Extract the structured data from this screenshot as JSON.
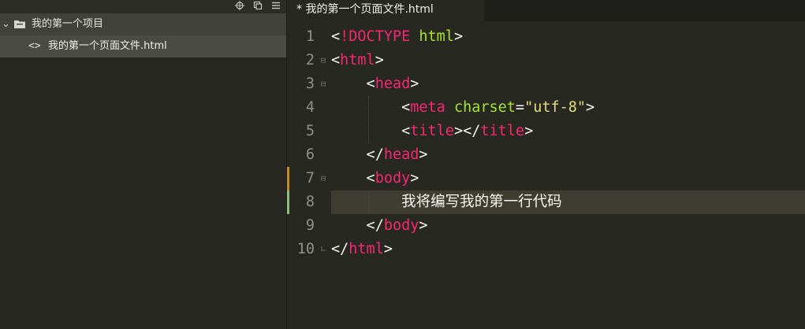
{
  "sidebar": {
    "toolbar": {
      "icons": [
        "crosshair-icon",
        "copy-icon",
        "menu-icon"
      ]
    },
    "project": {
      "name": "我的第一个项目",
      "expand_glyph": "⌄"
    },
    "file": {
      "name": "我的第一个页面文件.html",
      "glyph": "<>"
    }
  },
  "editor": {
    "tab": {
      "title": "* 我的第一个页面文件.html"
    },
    "code": {
      "lines": [
        {
          "num": "1",
          "fold": "",
          "parts": [
            {
              "c": "p",
              "t": "<"
            },
            {
              "c": "t",
              "t": "!DOCTYPE"
            },
            {
              "c": "p",
              "t": " "
            },
            {
              "c": "a",
              "t": "html"
            },
            {
              "c": "p",
              "t": ">"
            }
          ]
        },
        {
          "num": "2",
          "fold": "⊟",
          "parts": [
            {
              "c": "p",
              "t": "<"
            },
            {
              "c": "t",
              "t": "html"
            },
            {
              "c": "p",
              "t": ">"
            }
          ]
        },
        {
          "num": "3",
          "fold": "⊟",
          "parts": [
            {
              "c": "p",
              "t": "    <"
            },
            {
              "c": "t",
              "t": "head"
            },
            {
              "c": "p",
              "t": ">"
            }
          ]
        },
        {
          "num": "4",
          "fold": "",
          "parts": [
            {
              "c": "p",
              "t": "        <"
            },
            {
              "c": "t",
              "t": "meta"
            },
            {
              "c": "p",
              "t": " "
            },
            {
              "c": "a",
              "t": "charset"
            },
            {
              "c": "p",
              "t": "="
            },
            {
              "c": "s",
              "t": "\"utf-8\""
            },
            {
              "c": "p",
              "t": ">"
            }
          ]
        },
        {
          "num": "5",
          "fold": "",
          "parts": [
            {
              "c": "p",
              "t": "        <"
            },
            {
              "c": "t",
              "t": "title"
            },
            {
              "c": "p",
              "t": "></"
            },
            {
              "c": "t",
              "t": "title"
            },
            {
              "c": "p",
              "t": ">"
            }
          ]
        },
        {
          "num": "6",
          "fold": "",
          "parts": [
            {
              "c": "p",
              "t": "    </"
            },
            {
              "c": "t",
              "t": "head"
            },
            {
              "c": "p",
              "t": ">"
            }
          ]
        },
        {
          "num": "7",
          "fold": "⊟",
          "parts": [
            {
              "c": "p",
              "t": "    <"
            },
            {
              "c": "t",
              "t": "body"
            },
            {
              "c": "p",
              "t": ">"
            }
          ]
        },
        {
          "num": "8",
          "fold": "",
          "parts": [
            {
              "c": "p",
              "t": "        我将编写我的第一行代码"
            }
          ]
        },
        {
          "num": "9",
          "fold": "",
          "parts": [
            {
              "c": "p",
              "t": "    </"
            },
            {
              "c": "t",
              "t": "body"
            },
            {
              "c": "p",
              "t": ">"
            }
          ]
        },
        {
          "num": "10",
          "fold": "∟",
          "parts": [
            {
              "c": "p",
              "t": "</"
            },
            {
              "c": "t",
              "t": "html"
            },
            {
              "c": "p",
              "t": ">"
            }
          ]
        }
      ],
      "current_line": 8,
      "modified_lines": [
        7
      ],
      "added_lines": [
        8
      ]
    }
  },
  "colors": {
    "background": "#272822",
    "tag": "#f92672",
    "attribute": "#a6e22e",
    "string": "#e6db74",
    "text": "#f8f8f2",
    "modified_marker": "#c98a1f",
    "added_marker": "#8fbf7a"
  }
}
